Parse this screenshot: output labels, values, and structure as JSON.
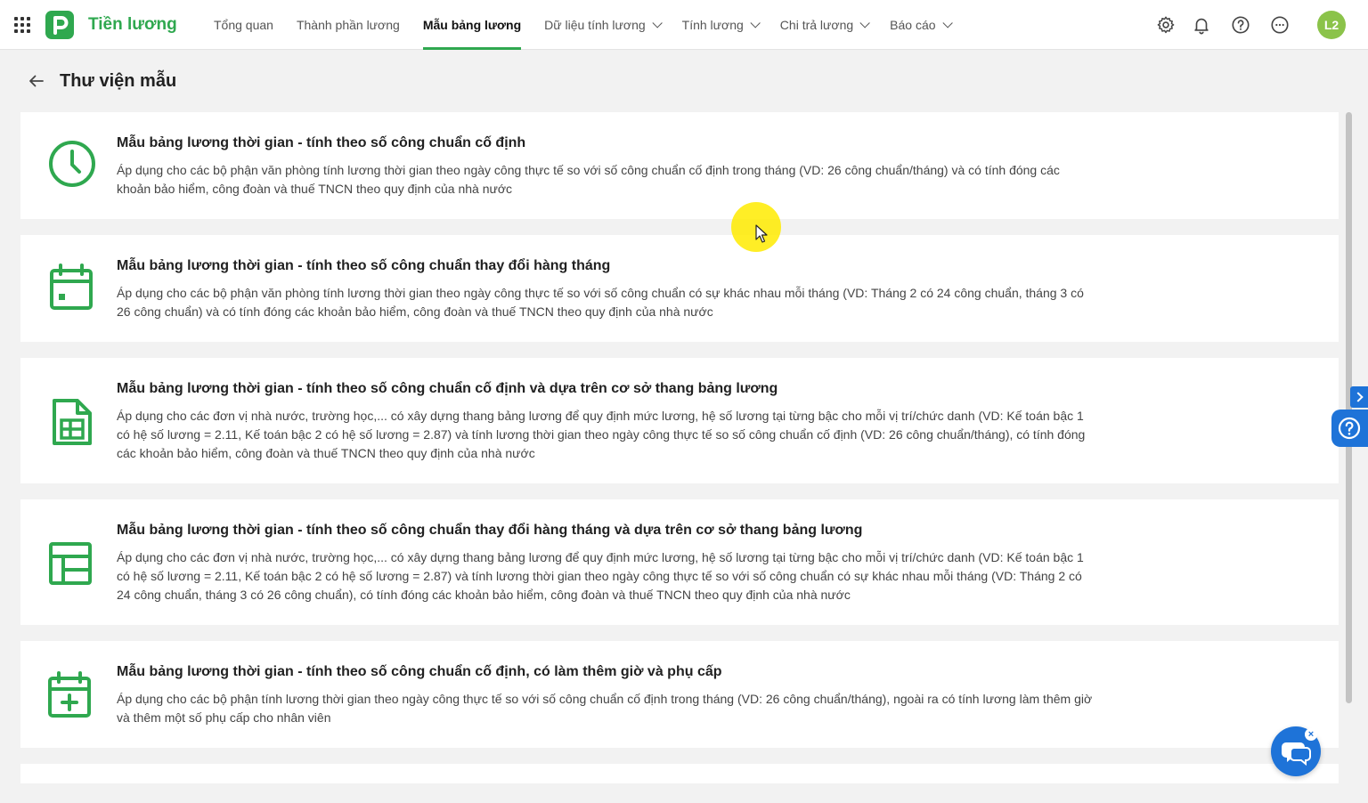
{
  "app": {
    "title": "Tiền lương",
    "accent_color": "#2fa84f",
    "secondary_color": "#1e73d8"
  },
  "nav": {
    "items": [
      {
        "label": "Tổng quan",
        "dropdown": false,
        "active": false
      },
      {
        "label": "Thành phần lương",
        "dropdown": false,
        "active": false
      },
      {
        "label": "Mẫu bảng lương",
        "dropdown": false,
        "active": true
      },
      {
        "label": "Dữ liệu tính lương",
        "dropdown": true,
        "active": false
      },
      {
        "label": "Tính lương",
        "dropdown": true,
        "active": false
      },
      {
        "label": "Chi trả lương",
        "dropdown": true,
        "active": false
      },
      {
        "label": "Báo cáo",
        "dropdown": true,
        "active": false
      }
    ]
  },
  "toolbar": {
    "icons": [
      "gear-icon",
      "bell-icon",
      "help-icon",
      "more-icon"
    ],
    "avatar_initials": "L2"
  },
  "page": {
    "title": "Thư viện mẫu"
  },
  "templates": [
    {
      "icon": "clock-icon",
      "title": "Mẫu bảng lương thời gian - tính theo số công chuẩn cố định",
      "desc": "Áp dụng cho các bộ phận văn phòng tính lương thời gian theo ngày công thực tế so với số công chuẩn cố định trong tháng (VD: 26 công chuẩn/tháng) và có tính đóng các khoản bảo hiểm, công đoàn và thuế TNCN theo quy định của nhà nước"
    },
    {
      "icon": "calendar-icon",
      "title": "Mẫu bảng lương thời gian - tính theo số công chuẩn thay đổi hàng tháng",
      "desc": "Áp dụng cho các bộ phận văn phòng tính lương thời gian theo ngày công thực tế so với số công chuẩn có sự khác nhau mỗi tháng (VD: Tháng 2 có 24 công chuẩn, tháng 3 có 26 công chuẩn) và có tính đóng các khoản bảo hiểm, công đoàn và thuế TNCN theo quy định của nhà nước"
    },
    {
      "icon": "spreadsheet-icon",
      "title": "Mẫu bảng lương thời gian - tính theo số công chuẩn cố định và dựa trên cơ sở thang bảng lương",
      "desc": "Áp dụng cho các đơn vị nhà nước, trường học,... có xây dựng thang bảng lương để quy định mức lương, hệ số lương tại từng bậc cho mỗi vị trí/chức danh (VD: Kế toán bậc 1 có hệ số lương = 2.11, Kế toán bậc 2 có hệ số lương = 2.87) và tính lương thời gian theo ngày công thực tế so số công chuẩn cố định (VD: 26 công chuẩn/tháng), có tính đóng các khoản bảo hiểm, công đoàn và thuế TNCN theo quy định của nhà nước"
    },
    {
      "icon": "table-icon",
      "title": "Mẫu bảng lương thời gian - tính theo số công chuẩn thay đổi hàng tháng và dựa trên cơ sở thang bảng lương",
      "desc": "Áp dụng cho các đơn vị nhà nước, trường học,... có xây dựng thang bảng lương để quy định mức lương, hệ số lương tại từng bậc cho mỗi vị trí/chức danh (VD: Kế toán bậc 1 có hệ số lương = 2.11, Kế toán bậc 2 có hệ số lương = 2.87) và tính lương thời gian theo ngày công thực tế so với số công chuẩn có sự khác nhau mỗi tháng (VD: Tháng 2 có 24 công chuẩn, tháng 3 có 26 công chuẩn), có tính đóng các khoản bảo hiểm, công đoàn và thuế TNCN theo quy định của nhà nước"
    },
    {
      "icon": "calendar-plus-icon",
      "title": "Mẫu bảng lương thời gian - tính theo số công chuẩn cố định, có làm thêm giờ và phụ cấp",
      "desc": "Áp dụng cho các bộ phận tính lương thời gian theo ngày công thực tế so với số công chuẩn cố định trong tháng (VD: 26 công chuẩn/tháng), ngoài ra có tính lương làm thêm giờ và thêm một số phụ cấp cho nhân viên"
    }
  ],
  "chat": {
    "close_label": "×"
  }
}
